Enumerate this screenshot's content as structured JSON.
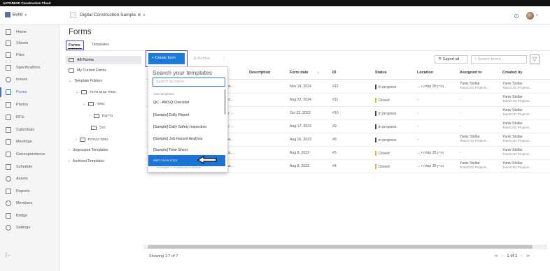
{
  "app": {
    "banner": "AUTODESK Construction Cloud"
  },
  "header": {
    "module": "Build",
    "project": "Digital Construction Sample",
    "help_icon": "help-icon"
  },
  "sidebar": {
    "items": [
      {
        "label": "Home",
        "icon": "home-icon"
      },
      {
        "label": "Sheets",
        "icon": "sheets-icon"
      },
      {
        "label": "Files",
        "icon": "files-icon"
      },
      {
        "label": "Specifications",
        "icon": "specifications-icon"
      },
      {
        "label": "Issues",
        "icon": "issues-icon"
      },
      {
        "label": "Forms",
        "icon": "forms-icon",
        "active": true
      },
      {
        "label": "Photos",
        "icon": "photos-icon"
      },
      {
        "label": "RFIs",
        "icon": "rfis-icon"
      },
      {
        "label": "Submittals",
        "icon": "submittals-icon"
      },
      {
        "label": "Meetings",
        "icon": "meetings-icon"
      },
      {
        "label": "Correspondence",
        "icon": "correspondence-icon"
      },
      {
        "label": "Schedule",
        "icon": "schedule-icon"
      },
      {
        "label": "Assets",
        "icon": "assets-icon"
      },
      {
        "label": "Reports",
        "icon": "reports-icon"
      },
      {
        "label": "Members",
        "icon": "members-icon"
      },
      {
        "label": "Bridge",
        "icon": "bridge-icon"
      },
      {
        "label": "Settings",
        "icon": "settings-icon"
      }
    ],
    "collapse": "|←"
  },
  "page": {
    "title": "Forms",
    "tabs": [
      "Forms",
      "Templates"
    ]
  },
  "tree": {
    "all_forms": "All Forms",
    "my_forms": "My Current Forms",
    "template_folders": "Template Folders",
    "folder_a": "טפסי קבוע איכות",
    "folder_b": "טפסי",
    "folder_c": "בדיקות",
    "folder_d": "הכל",
    "folder_e": "טפסי בטיחות",
    "ungrouped": "Ungrouped Templates",
    "archived": "Archived Templates"
  },
  "toolbar": {
    "create": "+ Create form",
    "archive": "Archive",
    "more": "⋮",
    "export": "Export all",
    "search_placeholder": "Search forms..."
  },
  "table": {
    "headers": [
      "Description",
      "Form date",
      "ID",
      "Status",
      "Location",
      "Assigned to",
      "Created by"
    ],
    "rows": [
      {
        "name": "ns...",
        "desc": "",
        "date": "Nov 19, 2024",
        "id": "#12",
        "status": "In progress",
        "status_color": "#444444",
        "loc": "... • בניין 35 קומה",
        "assigned": "Yaniv Stollar",
        "assigned_sub": "TeamCAD Projects...",
        "created": "Yaniv Stollar",
        "created_sub": "TeamCAD Projects..."
      },
      {
        "name": "ec...",
        "desc": "",
        "date": "Aug 22, 2024",
        "id": "#11",
        "status": "Closed",
        "status_color": "#e0b43a",
        "loc": "-",
        "assigned": "-",
        "assigned_sub": "",
        "created": "Yaniv Stollar",
        "created_sub": "TeamCAD Projects..."
      },
      {
        "name": "ly ...",
        "desc": "",
        "date": "Oct 22, 2023",
        "id": "#10",
        "status": "In progress",
        "status_color": "#444444",
        "loc": "-",
        "assigned": "-",
        "assigned_sub": "",
        "created": "Yaniv Stollar",
        "created_sub": "TeamCAD Projects..."
      },
      {
        "name": "ly ...",
        "desc": "",
        "date": "Aug 17, 2023",
        "id": "#9",
        "status": "In progress",
        "status_color": "#444444",
        "loc": "-",
        "assigned": "-",
        "assigned_sub": "",
        "created": "Yaniv Stollar",
        "created_sub": "TeamCAD Projects..."
      },
      {
        "name": "ns...",
        "desc": "",
        "date": "Aug 16, 2023",
        "id": "#6",
        "status": "In progress",
        "status_color": "#444444",
        "loc": "-",
        "assigned": "Yaniv Stollar",
        "assigned_sub": "TeamCAD Projects...",
        "created": "Yaniv Stollar",
        "created_sub": "TeamCAD Projects..."
      },
      {
        "name": "ns...",
        "desc": "",
        "date": "Aug 8, 2023",
        "id": "#5",
        "status": "Closed",
        "status_color": "#e0b43a",
        "loc": "... • בניין 35 קומה",
        "assigned": "-",
        "assigned_sub": "",
        "created": "Yaniv Stollar",
        "created_sub": "TeamCAD Projects..."
      },
      {
        "name": "ns...",
        "desc": "",
        "date": "Aug 8, 2023",
        "id": "#4",
        "status": "Closed",
        "status_color": "#e0b43a",
        "loc": "... • בניין 35 קומה",
        "assigned": "Yaniv Stollar",
        "assigned_sub": "TeamCAD Projects...",
        "created": "Yaniv Stollar",
        "created_sub": "TeamCAD Projects..."
      }
    ]
  },
  "dropdown": {
    "title": "Search your templates",
    "search_placeholder": "Search by name",
    "caption": "Your templates",
    "items": [
      "QC - AMSQ Checklist",
      "[Sample] Daily Report",
      "[Sample] Daily Safety Inspection",
      "[Sample] Job Hazard Analysis",
      "[Sample] Time Sheet",
      "בקרת איכות ביסוס"
    ],
    "footer": "↑↓ to navigate   ↵ to select   esc to dismiss"
  },
  "footer": {
    "showing": "Showing 1-7 of 7",
    "pager_first": "≪",
    "pager_prev": "‹",
    "pager_page": "1 of 1",
    "pager_next": "›",
    "pager_last": "≫"
  },
  "colors": {
    "accent": "#1d7ad6",
    "highlight_border": "#3a45b6",
    "closed": "#e0b43a"
  }
}
